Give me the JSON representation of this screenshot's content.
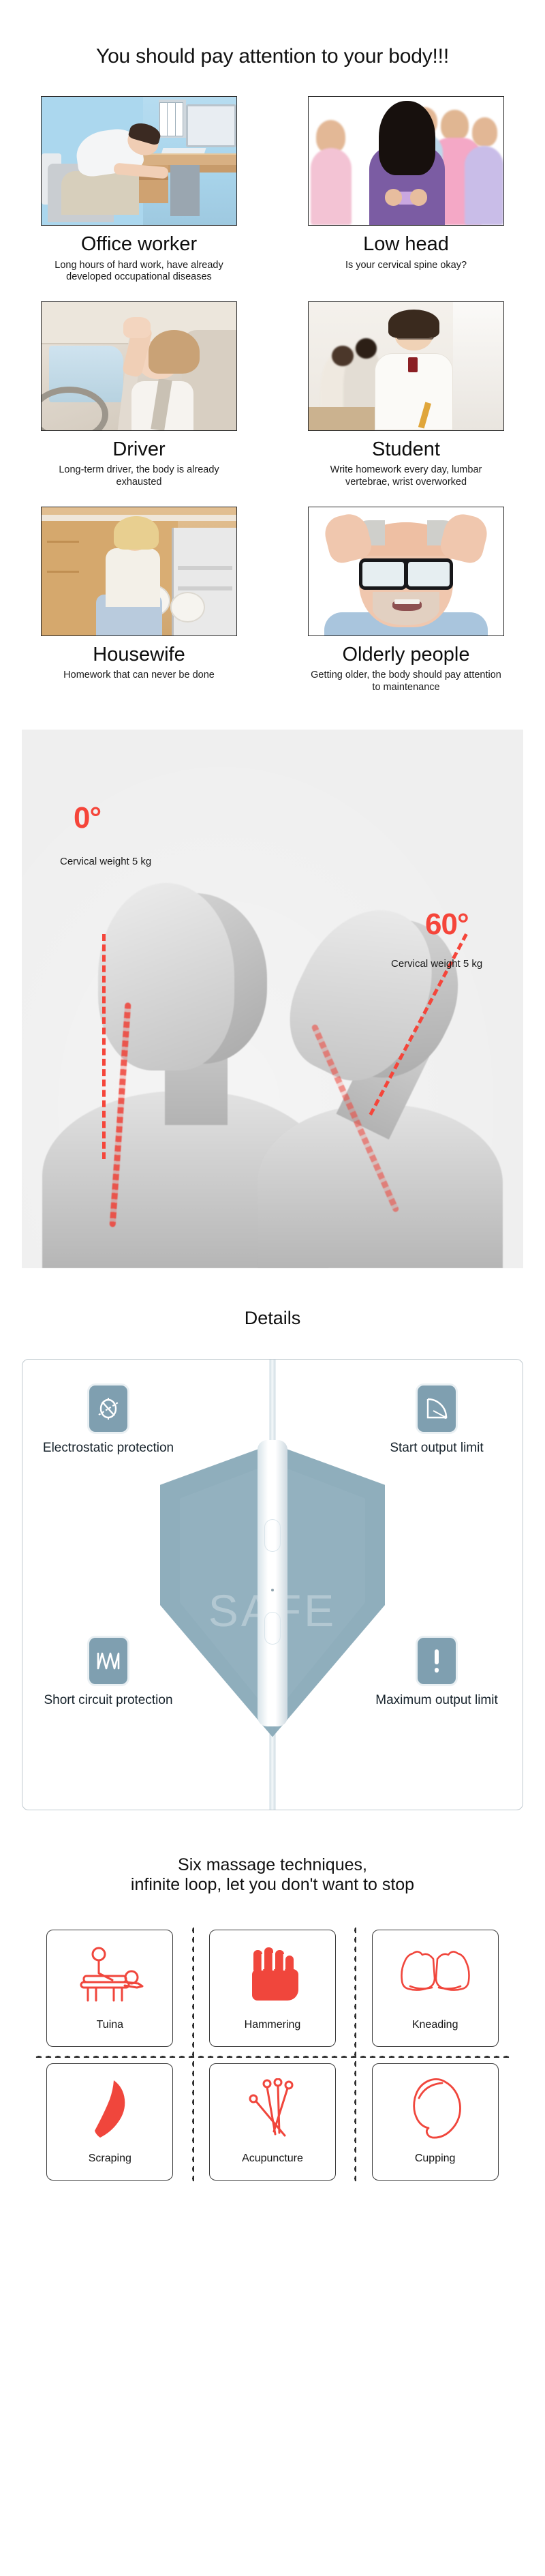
{
  "hero": {
    "title": "You should pay attention to your body!!!",
    "personas": [
      {
        "name": "Office worker",
        "desc": "Long hours of hard work, have already developed occupational diseases",
        "photo": "office-worker-slumped-at-desk-photo"
      },
      {
        "name": "Low head",
        "desc": "Is your cervical spine okay?",
        "photo": "woman-looking-down-at-phone-photo"
      },
      {
        "name": "Driver",
        "desc": "Long-term driver, the body is already exhausted",
        "photo": "tired-driver-in-car-photo"
      },
      {
        "name": "Student",
        "desc": "Write homework every day, lumbar vertebrae, wrist overworked",
        "photo": "student-writing-at-desk-photo"
      },
      {
        "name": "Housewife",
        "desc": "Homework that can never be done",
        "photo": "housewife-loading-dishwasher-photo"
      },
      {
        "name": "Olderly people",
        "desc": "Getting older, the body should pay attention to maintenance",
        "photo": "elderly-man-holding-head-photo"
      }
    ]
  },
  "cervical": {
    "image_name": "cervical-spine-angle-diagram",
    "angle_zero": "0°",
    "angle_zero_caption": "Cervical weight 5 kg",
    "angle_sixty": "60°",
    "angle_sixty_caption": "Cervical weight 5 kg",
    "accent_color": "#f5453a",
    "background_color": "#efefef"
  },
  "details": {
    "title": "Details",
    "shield_word": "SAFE",
    "icon_color": "#7f9fb0",
    "features": [
      {
        "label": "Electrostatic protection",
        "icon": "electrostatic-icon"
      },
      {
        "label": "Start output limit",
        "icon": "angle-gauge-icon"
      },
      {
        "label": "Short circuit protection",
        "icon": "waveform-icon"
      },
      {
        "label": "Maximum output limit",
        "icon": "exclamation-icon"
      }
    ]
  },
  "massage": {
    "title_line1": "Six massage techniques,",
    "title_line2": "infinite loop, let you don't want to stop",
    "accent_color": "#f0463c",
    "techniques": [
      {
        "label": "Tuina",
        "icon": "massage-table-icon"
      },
      {
        "label": "Hammering",
        "icon": "fist-icon"
      },
      {
        "label": "Kneading",
        "icon": "two-hands-kneading-icon"
      },
      {
        "label": "Scraping",
        "icon": "gua-sha-scraper-icon"
      },
      {
        "label": "Acupuncture",
        "icon": "acupuncture-needles-icon"
      },
      {
        "label": "Cupping",
        "icon": "cupping-jar-icon"
      }
    ]
  }
}
